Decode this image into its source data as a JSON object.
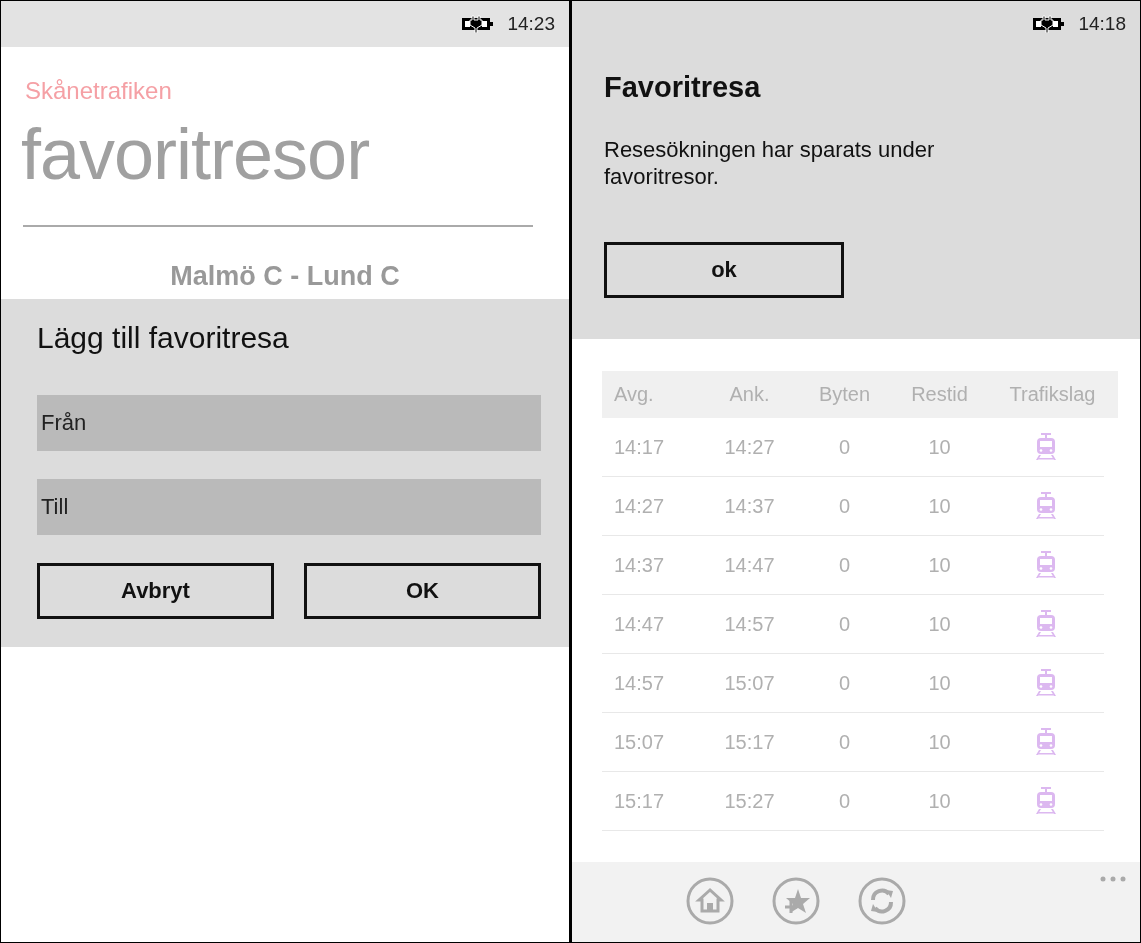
{
  "screens": [
    {
      "status_bar": {
        "time": "14:23"
      },
      "app_name": "Skånetrafiken",
      "page_title": "favoritresor",
      "trip": "Malmö C - Lund C",
      "dialog": {
        "title": "Lägg till favoritresa",
        "fields": [
          {
            "placeholder": "Från"
          },
          {
            "placeholder": "Till"
          }
        ],
        "buttons": [
          "Avbryt",
          "OK"
        ]
      }
    },
    {
      "status_bar": {
        "time": "14:18"
      },
      "message_box": {
        "title": "Favoritresa",
        "text": "Resesökningen har sparats under favoritresor.",
        "button": "ok"
      },
      "table": {
        "columns": [
          "Avg.",
          "Ank.",
          "Byten",
          "Restid",
          "Trafikslag"
        ],
        "rows": [
          {
            "departure": "14:17",
            "arrival": "14:27",
            "changes": "0",
            "duration": "10",
            "kind": "train"
          },
          {
            "departure": "14:27",
            "arrival": "14:37",
            "changes": "0",
            "duration": "10",
            "kind": "train"
          },
          {
            "departure": "14:37",
            "arrival": "14:47",
            "changes": "0",
            "duration": "10",
            "kind": "train"
          },
          {
            "departure": "14:47",
            "arrival": "14:57",
            "changes": "0",
            "duration": "10",
            "kind": "train"
          },
          {
            "departure": "14:57",
            "arrival": "15:07",
            "changes": "0",
            "duration": "10",
            "kind": "train"
          },
          {
            "departure": "15:07",
            "arrival": "15:17",
            "changes": "0",
            "duration": "10",
            "kind": "train"
          },
          {
            "departure": "15:17",
            "arrival": "15:27",
            "changes": "0",
            "duration": "10",
            "kind": "train"
          }
        ]
      },
      "app_bar": {
        "buttons": [
          {
            "kind": "home"
          },
          {
            "kind": "favorite"
          },
          {
            "kind": "refresh"
          }
        ]
      }
    }
  ]
}
